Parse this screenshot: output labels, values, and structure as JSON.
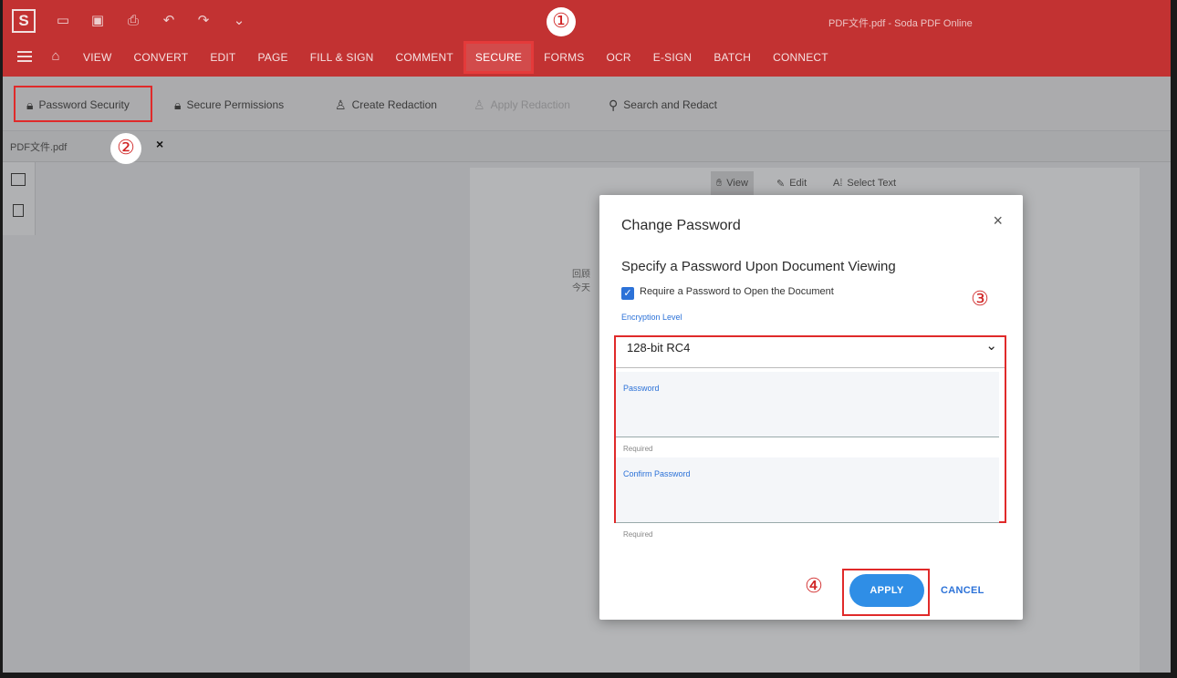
{
  "app": {
    "logo": "S",
    "window_title": "PDF文件.pdf - Soda PDF Online"
  },
  "menu": {
    "items": [
      "VIEW",
      "CONVERT",
      "EDIT",
      "PAGE",
      "FILL & SIGN",
      "COMMENT",
      "SECURE",
      "FORMS",
      "OCR",
      "E-SIGN",
      "BATCH",
      "CONNECT"
    ],
    "active": "SECURE"
  },
  "toolbar": {
    "password_security": "Password Security",
    "secure_permissions": "Secure Permissions",
    "create_redaction": "Create Redaction",
    "apply_redaction": "Apply Redaction",
    "search_and_redact": "Search and Redact"
  },
  "file_tab": {
    "name": "PDF文件.pdf",
    "close": "×"
  },
  "page_tools": {
    "view": "View",
    "edit": "Edit",
    "select_text": "Select Text"
  },
  "document": {
    "line1": "回顾",
    "line2": "今天"
  },
  "modal": {
    "title": "Change Password",
    "close": "×",
    "subtitle": "Specify a Password Upon Document Viewing",
    "checkbox_label": "Require a Password to Open the Document",
    "checkbox_checked": true,
    "encryption_label": "Encryption Level",
    "encryption_value": "128-bit RC4",
    "password_label": "Password",
    "password_required": "Required",
    "confirm_label": "Confirm Password",
    "confirm_required": "Required",
    "apply": "APPLY",
    "cancel": "CANCEL"
  },
  "markers": {
    "m1": "①",
    "m2": "②",
    "m3": "③",
    "m4": "④"
  },
  "colors": {
    "brand_red": "#c23232",
    "highlight_red": "#e02a2a",
    "primary_blue": "#2f8ee6"
  }
}
